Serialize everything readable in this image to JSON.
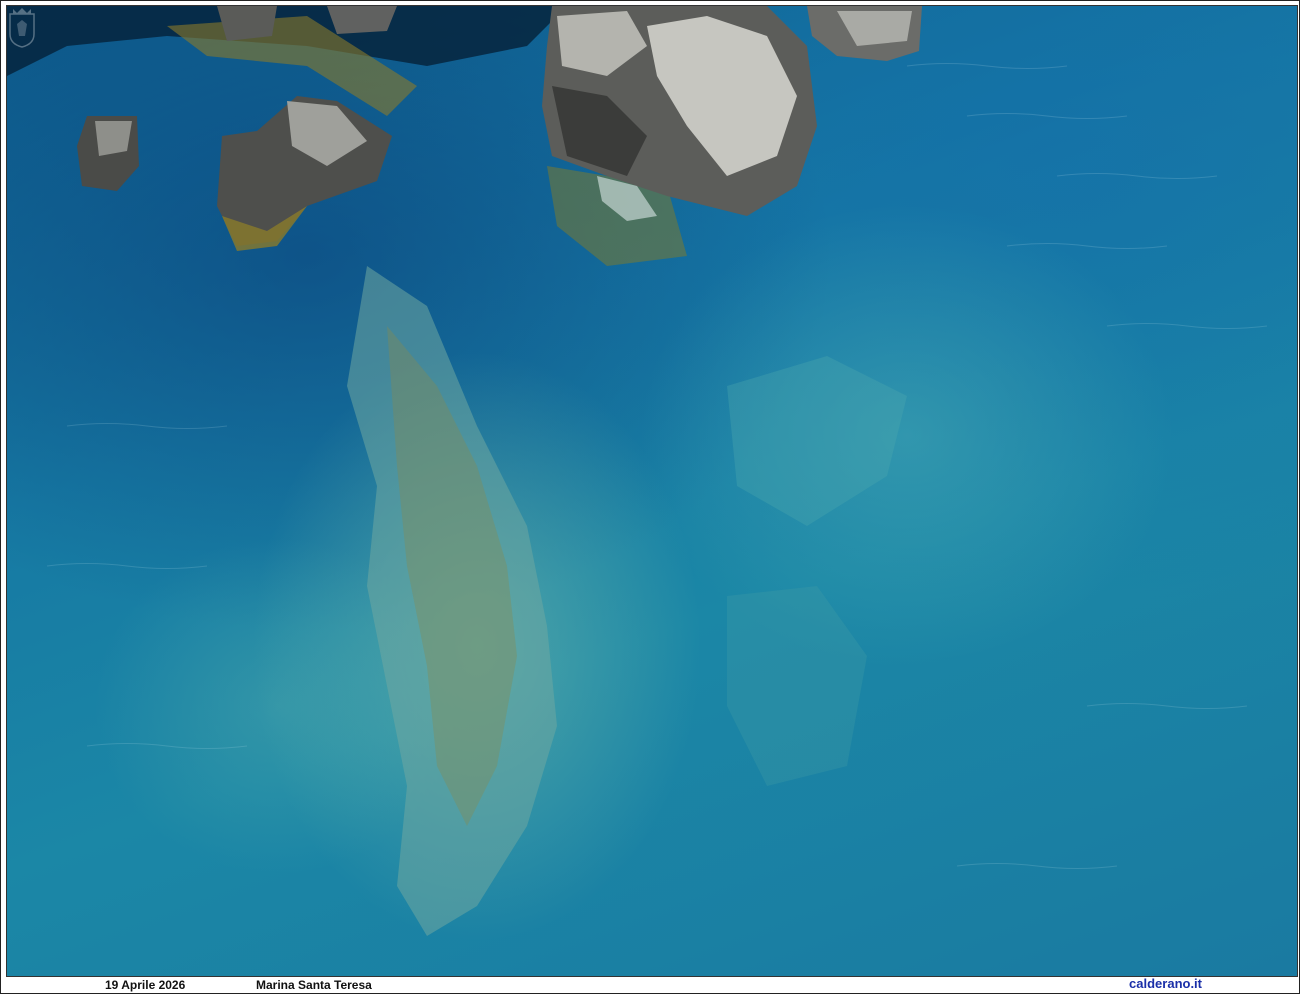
{
  "caption": {
    "date": "19 Aprile 2026",
    "place": "Marina Santa Teresa",
    "site": "calderano.it"
  },
  "photo": {
    "subject": "aerial-sea-rocks",
    "colors": {
      "deep_water": "#0d5c8d",
      "shallow_water": "#3fa9b0",
      "rock": "#5a5a55",
      "rock_light": "#c9c9c4",
      "algae": "#8a7a2a"
    }
  },
  "watermark": {
    "icon": "crest-icon"
  }
}
